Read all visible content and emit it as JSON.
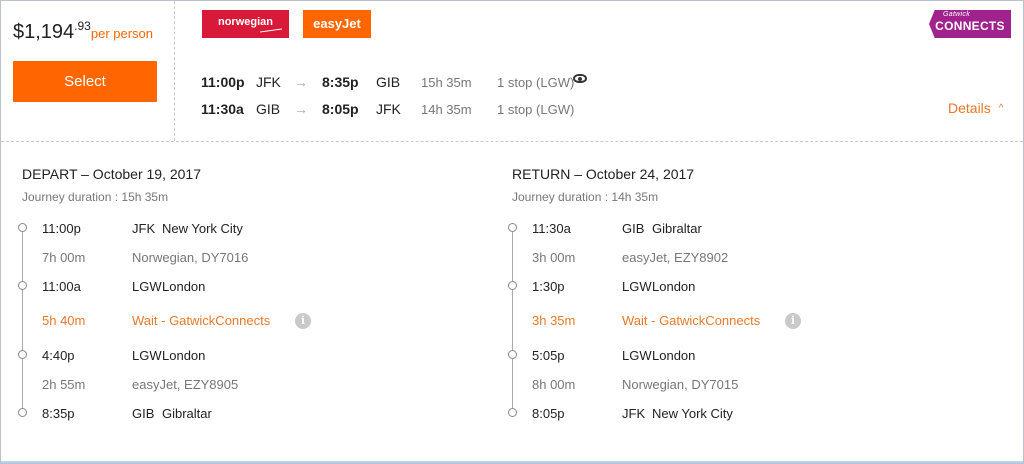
{
  "price": {
    "amount": "$1,194",
    "cents": ".93",
    "per_person": "per person"
  },
  "select_label": "Select",
  "logos": {
    "norwegian": "norwegian",
    "easyjet": "easyJet",
    "gatwick_small": "Gatwick",
    "gatwick_big": "CONNECTS"
  },
  "outbound_summary": {
    "depart_time": "11:00p",
    "from": "JFK",
    "arrive_time": "8:35p",
    "to": "GIB",
    "duration": "15h 35m",
    "stops": "1 stop (LGW)"
  },
  "return_summary": {
    "depart_time": "11:30a",
    "from": "GIB",
    "arrive_time": "8:05p",
    "to": "JFK",
    "duration": "14h 35m",
    "stops": "1 stop (LGW)"
  },
  "details_label": "Details",
  "depart_leg": {
    "title": "DEPART – October 19, 2017",
    "journey": "Journey duration : 15h 35m",
    "rows": [
      {
        "time": "11:00p",
        "code": "JFK",
        "city": "New York City"
      },
      {
        "time": "7h 00m",
        "info": "Norwegian, DY7016"
      },
      {
        "time": "11:00a",
        "code": "LGW",
        "city": "London"
      },
      {
        "time": "5h 40m",
        "info": "Wait - GatwickConnects"
      },
      {
        "time": "4:40p",
        "code": "LGW",
        "city": "London"
      },
      {
        "time": "2h 55m",
        "info": "easyJet, EZY8905"
      },
      {
        "time": "8:35p",
        "code": "GIB",
        "city": "Gibraltar"
      }
    ]
  },
  "return_leg": {
    "title": "RETURN – October 24, 2017",
    "journey": "Journey duration : 14h 35m",
    "rows": [
      {
        "time": "11:30a",
        "code": "GIB",
        "city": "Gibraltar"
      },
      {
        "time": "3h 00m",
        "info": "easyJet, EZY8902"
      },
      {
        "time": "1:30p",
        "code": "LGW",
        "city": "London"
      },
      {
        "time": "3h 35m",
        "info": "Wait - GatwickConnects"
      },
      {
        "time": "5:05p",
        "code": "LGW",
        "city": "London"
      },
      {
        "time": "8h 00m",
        "info": "Norwegian, DY7015"
      },
      {
        "time": "8:05p",
        "code": "JFK",
        "city": "New York City"
      }
    ]
  },
  "colors": {
    "accent": "#ff6600",
    "norwegian": "#d81939",
    "gatwick": "#a0228d",
    "wait": "#e8792a"
  }
}
